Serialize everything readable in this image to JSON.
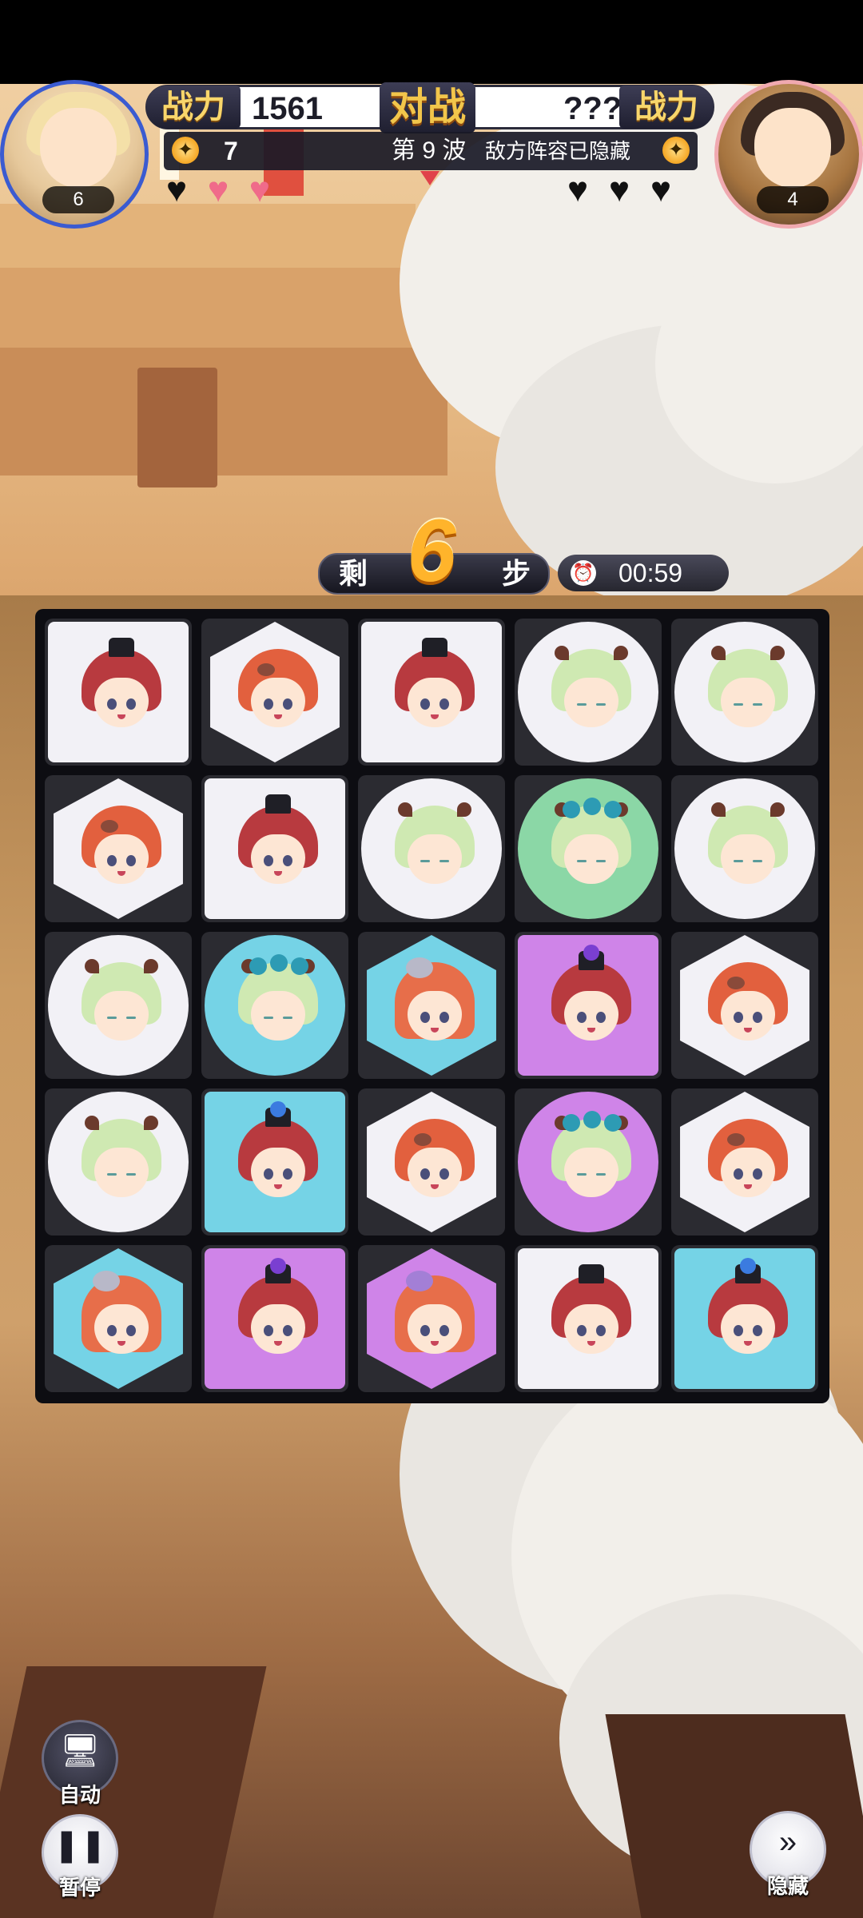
{
  "hud": {
    "power_label": "战力",
    "player_power": "1561",
    "vs_label": "对战",
    "enemy_power": "???",
    "enemy_power_label": "战力",
    "star_count": "7",
    "wave": "第 9 波",
    "enemy_status": "敌方阵容已隐藏",
    "player_team_count": "6",
    "enemy_team_count": "4"
  },
  "lives": {
    "player": [
      "dark",
      "pink",
      "pink"
    ],
    "enemy": [
      "dark",
      "dark",
      "dark"
    ]
  },
  "steps": {
    "prefix": "剩",
    "value": "6",
    "suffix": "步"
  },
  "timer": {
    "value": "00:59",
    "icon": "alarm-clock-icon"
  },
  "board": {
    "rows": 5,
    "cols": 5,
    "tiles": [
      [
        "red-hat-square",
        "orange-hex",
        "red-hat-square",
        "green-elf-circle",
        "green-elf-circle"
      ],
      [
        "orange-hex",
        "red-hat-square",
        "green-elf-circle",
        "green-elf-flower-circle-green",
        "green-elf-circle"
      ],
      [
        "green-elf-circle",
        "green-elf-flower-circle-blue",
        "ginger-hex-blue",
        "red-hat-square-purple",
        "orange-hex"
      ],
      [
        "green-elf-circle",
        "red-hat-square-blue",
        "orange-hex",
        "green-elf-flower-circle-purple",
        "orange-hex"
      ],
      [
        "ginger-hex-blue",
        "red-hat-square-purple",
        "ginger-hex-purple",
        "red-hat-square",
        "red-hat-square-blue"
      ]
    ]
  },
  "controls": {
    "auto_label": "自动",
    "pause_label": "暂停",
    "hide_label": "隐藏"
  }
}
